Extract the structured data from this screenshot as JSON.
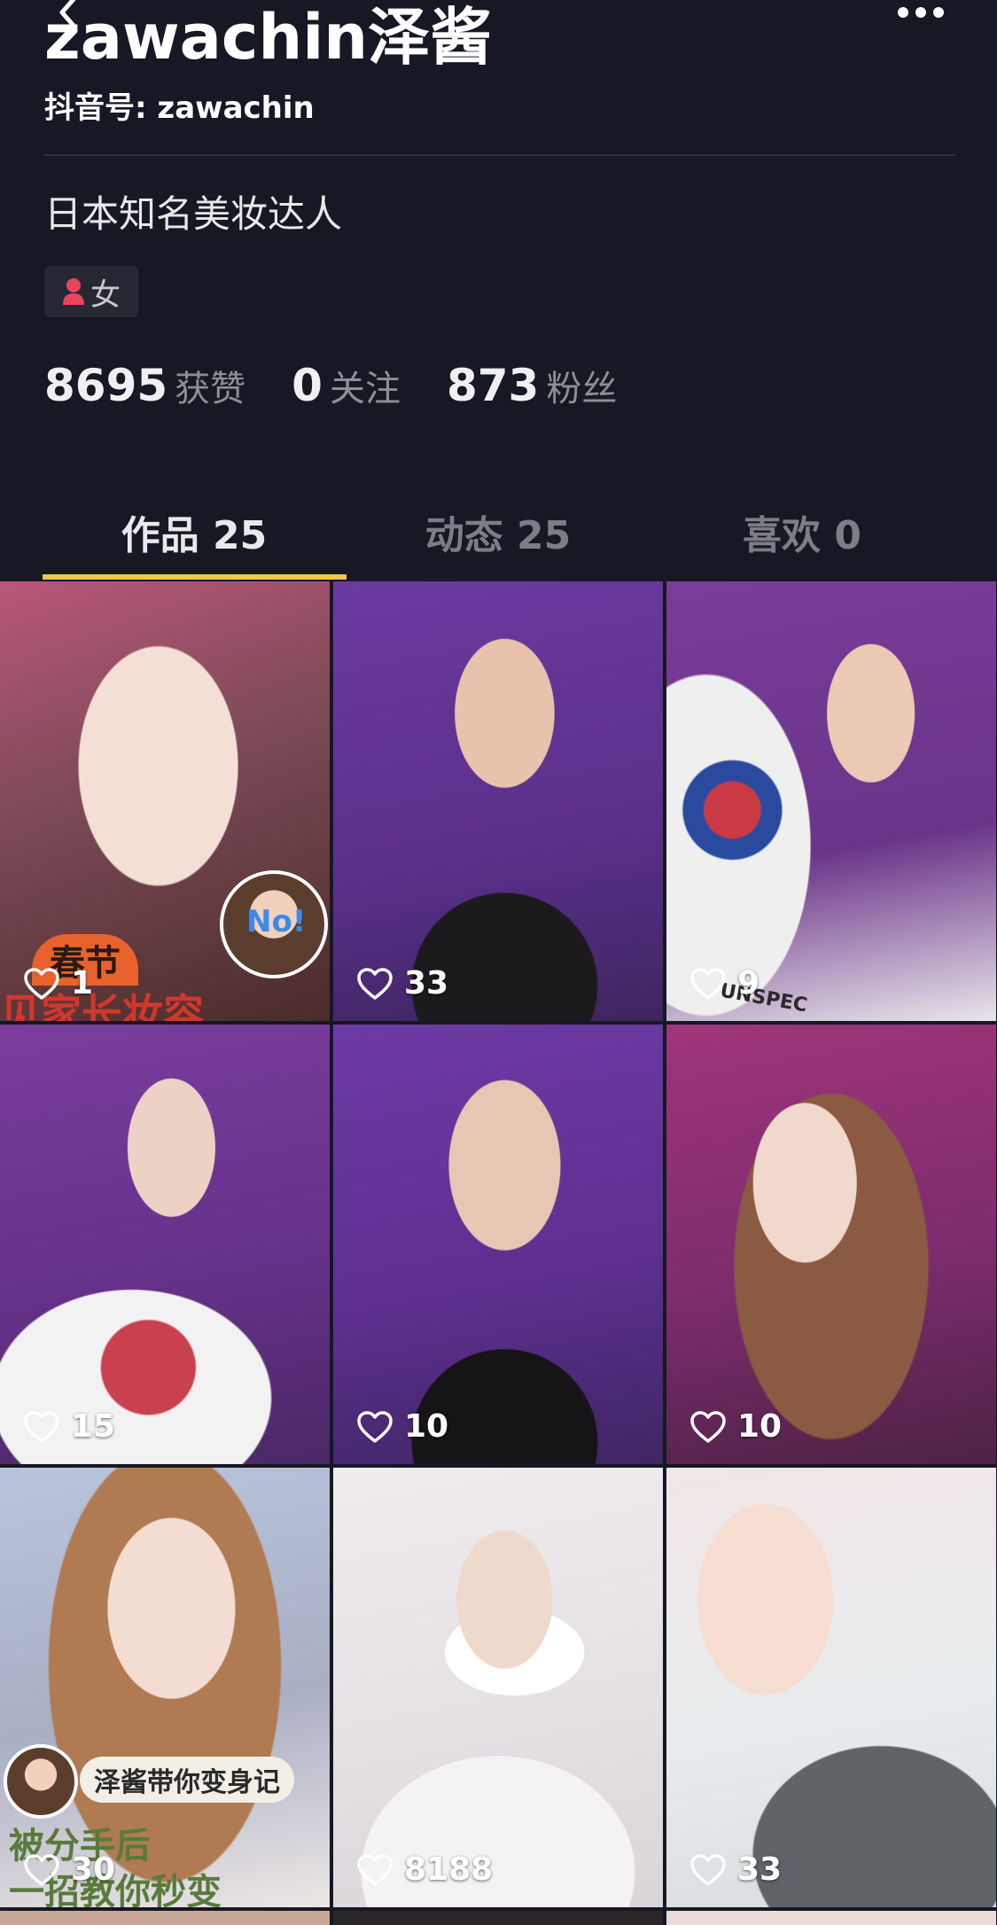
{
  "profile": {
    "nickname": "zawachin泽酱",
    "douyin_id": "抖音号: zawachin",
    "bio": "日本知名美妆达人",
    "gender": "女",
    "stats": [
      {
        "value": "8695",
        "label": "获赞"
      },
      {
        "value": "0",
        "label": "关注"
      },
      {
        "value": "873",
        "label": "粉丝"
      }
    ]
  },
  "tabs": [
    {
      "label": "作品 25",
      "active": true
    },
    {
      "label": "动态 25",
      "active": false
    },
    {
      "label": "喜欢 0",
      "active": false
    }
  ],
  "videos": [
    {
      "likes": "1",
      "overlay": [
        "春节",
        "见家长妆容"
      ],
      "sticker": "No!"
    },
    {
      "likes": "33"
    },
    {
      "likes": "9",
      "overlay": [
        "UNSPEC"
      ]
    },
    {
      "likes": "15"
    },
    {
      "likes": "10"
    },
    {
      "likes": "10"
    },
    {
      "likes": "30",
      "overlay": [
        "泽酱带你变身记",
        "被分手后",
        "一招教你秒变"
      ]
    },
    {
      "likes": "8188"
    },
    {
      "likes": "33"
    }
  ],
  "colors": {
    "background": "#161823",
    "tab_indicator": "#f6c54a",
    "gender_icon": "#e8455b"
  },
  "icons": [
    "back-arrow-icon",
    "more-dots-icon",
    "female-user-icon",
    "heart-outline-icon"
  ]
}
